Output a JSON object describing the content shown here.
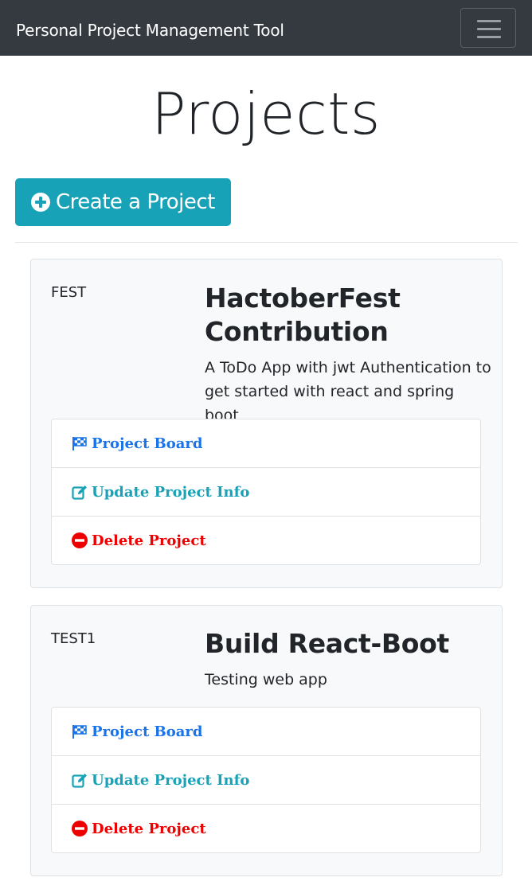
{
  "navbar": {
    "brand": "Personal Project Management Tool",
    "toggler_icon": "hamburger-menu-icon"
  },
  "page": {
    "title": "Projects",
    "create_button": {
      "label": "Create a Project",
      "icon": "plus-circle-icon"
    }
  },
  "projects": [
    {
      "id": "FEST",
      "name": "HactoberFest Contribution",
      "description": "A ToDo App with jwt Authentication to get started with react and spring boot",
      "actions": [
        {
          "label": "Project Board",
          "icon": "checkered-flag-icon"
        },
        {
          "label": "Update Project Info",
          "icon": "edit-icon"
        },
        {
          "label": "Delete Project",
          "icon": "minus-circle-icon"
        }
      ]
    },
    {
      "id": "TEST1",
      "name": "Build React-Boot",
      "description": "Testing web app",
      "actions": [
        {
          "label": "Project Board",
          "icon": "checkered-flag-icon"
        },
        {
          "label": "Update Project Info",
          "icon": "edit-icon"
        },
        {
          "label": "Delete Project",
          "icon": "minus-circle-icon"
        }
      ]
    }
  ],
  "colors": {
    "navbar": "#343a40",
    "accent": "#17a2b8",
    "board_link": "#1a73e8",
    "delete_link": "#ee0000",
    "card_bg": "#f8f9fa"
  }
}
